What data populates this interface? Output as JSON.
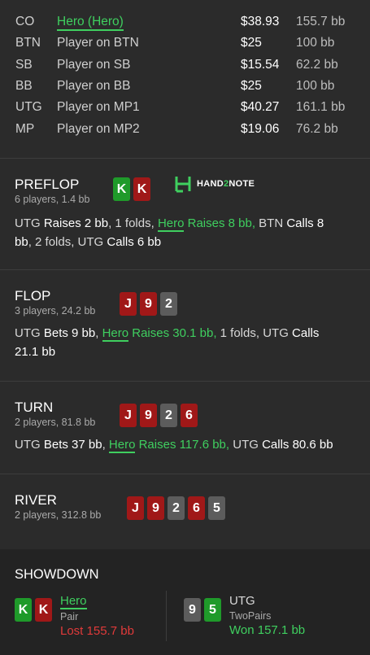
{
  "players": [
    {
      "pos": "CO",
      "name": "Hero (Hero)",
      "hero": true,
      "stack": "$38.93",
      "bb": "155.7 bb"
    },
    {
      "pos": "BTN",
      "name": "Player on BTN",
      "hero": false,
      "stack": "$25",
      "bb": "100 bb"
    },
    {
      "pos": "SB",
      "name": "Player on SB",
      "hero": false,
      "stack": "$15.54",
      "bb": "62.2 bb"
    },
    {
      "pos": "BB",
      "name": "Player on BB",
      "hero": false,
      "stack": "$25",
      "bb": "100 bb"
    },
    {
      "pos": "UTG",
      "name": "Player on MP1",
      "hero": false,
      "stack": "$40.27",
      "bb": "161.1 bb"
    },
    {
      "pos": "MP",
      "name": "Player on MP2",
      "hero": false,
      "stack": "$19.06",
      "bb": "76.2 bb"
    }
  ],
  "logo": {
    "text_a": "HAND",
    "text_b": "2",
    "text_c": "NOTE"
  },
  "preflop": {
    "title": "PREFLOP",
    "sub": "6 players, 1.4 bb",
    "cards": [
      "K",
      "K"
    ],
    "a1": "UTG ",
    "a2": "Raises 2 bb",
    "a3": ", 1 folds, ",
    "a4": "Hero",
    "a5": " Raises 8 bb,",
    "a6": " BTN ",
    "a7": "Calls 8",
    "a8": "bb",
    "a9": ", 2 folds, UTG ",
    "a10": "Calls 6 bb"
  },
  "flop": {
    "title": "FLOP",
    "sub": "3 players, 24.2 bb",
    "cards": [
      "J",
      "9",
      "2"
    ],
    "a1": "UTG ",
    "a2": "Bets 9 bb",
    "a3": ", ",
    "a4": "Hero",
    "a5": " Raises 30.1 bb,",
    "a6": " 1 folds, UTG ",
    "a7": "Calls",
    "a8": "21.1 bb"
  },
  "turn": {
    "title": "TURN",
    "sub": "2 players, 81.8 bb",
    "cards": [
      "J",
      "9",
      "2",
      "6"
    ],
    "a1": "UTG ",
    "a2": "Bets 37 bb",
    "a3": ", ",
    "a4": "Hero",
    "a5": " Raises 117.6 bb,",
    "a6": " UTG ",
    "a7": "Calls 80.6 bb"
  },
  "river": {
    "title": "RIVER",
    "sub": "2 players, 312.8 bb",
    "cards": [
      "J",
      "9",
      "2",
      "6",
      "5"
    ]
  },
  "showdown": {
    "title": "SHOWDOWN",
    "hero": {
      "cards": [
        "K",
        "K"
      ],
      "name": "Hero",
      "hand": "Pair",
      "result": "Lost 155.7 bb"
    },
    "villain": {
      "cards": [
        "9",
        "5"
      ],
      "name": "UTG",
      "hand": "TwoPairs",
      "result": "Won 157.1 bb"
    }
  },
  "colors": {
    "red": "#a01818",
    "green": "#1f9a2a",
    "gray": "#5c5c5c",
    "hero_green": "#3fcf5f",
    "loss_red": "#e03a3a"
  }
}
